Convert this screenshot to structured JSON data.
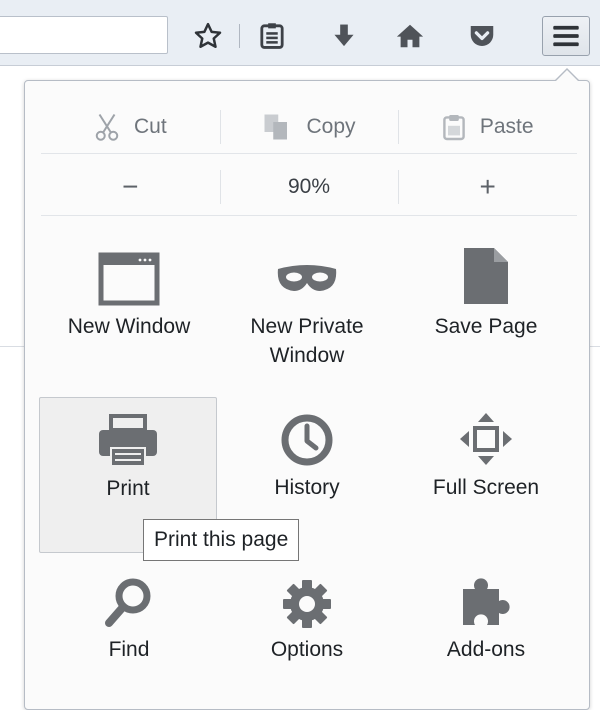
{
  "edit": {
    "cut": "Cut",
    "copy": "Copy",
    "paste": "Paste"
  },
  "zoom": {
    "out": "−",
    "level": "90%",
    "in": "+"
  },
  "grid": {
    "new_window": "New Window",
    "new_private_window_line1": "New Private",
    "new_private_window_line2": "Window",
    "save_page": "Save Page",
    "print": "Print",
    "history": "History",
    "full_screen": "Full Screen",
    "find": "Find",
    "options": "Options",
    "add_ons": "Add-ons"
  },
  "tooltip": "Print this page",
  "icons": {
    "bookmark": "star-icon",
    "bookmarks_list": "bookmarks-list-icon",
    "downloads": "download-icon",
    "home": "home-icon",
    "pocket": "pocket-icon",
    "menu": "hamburger-menu-icon"
  },
  "colors": {
    "icon_gray": "#6b6e72",
    "toolbar_icon": "#4f5359",
    "hover_bg": "#efefef"
  }
}
